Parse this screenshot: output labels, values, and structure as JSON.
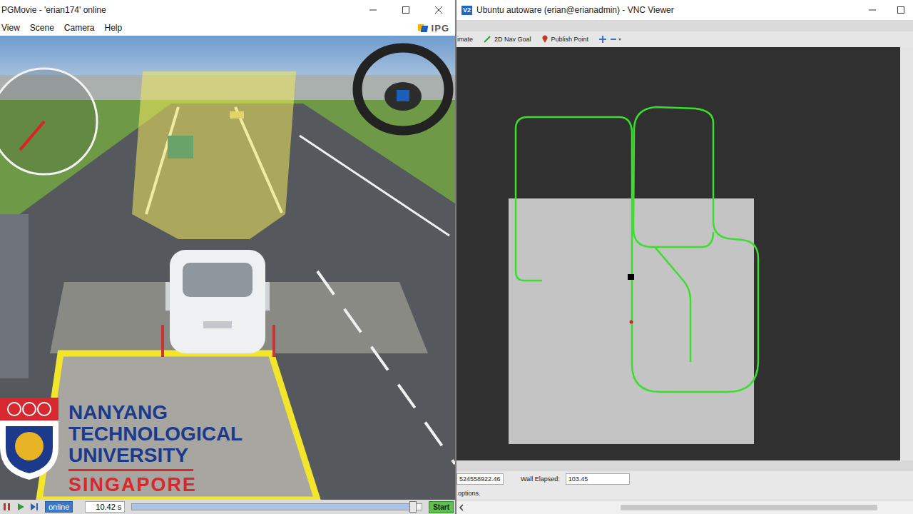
{
  "left_window": {
    "title": "PGMovie - 'erian174' online",
    "menu": [
      "View",
      "Scene",
      "Camera",
      "Help"
    ],
    "brand": "IPG",
    "watermark": {
      "lines": [
        "NANYANG",
        "TECHNOLOGICAL",
        "UNIVERSITY"
      ],
      "country": "SINGAPORE"
    },
    "playback": {
      "mode": {
        "label": "online",
        "highlighted": true
      },
      "time": "10.42 s",
      "level": 0.97,
      "start": "Start"
    }
  },
  "right_window": {
    "title": "Ubuntu autoware (erian@erianadmin) - VNC Viewer",
    "app_icon": "V2",
    "tools": [
      "imate",
      "2D Nav Goal",
      "Publish Point"
    ],
    "status": {
      "time_value": "524558922.46",
      "wall_elapsed_label": "Wall Elapsed:",
      "wall_elapsed_value": "103.45",
      "hint": "options."
    }
  }
}
